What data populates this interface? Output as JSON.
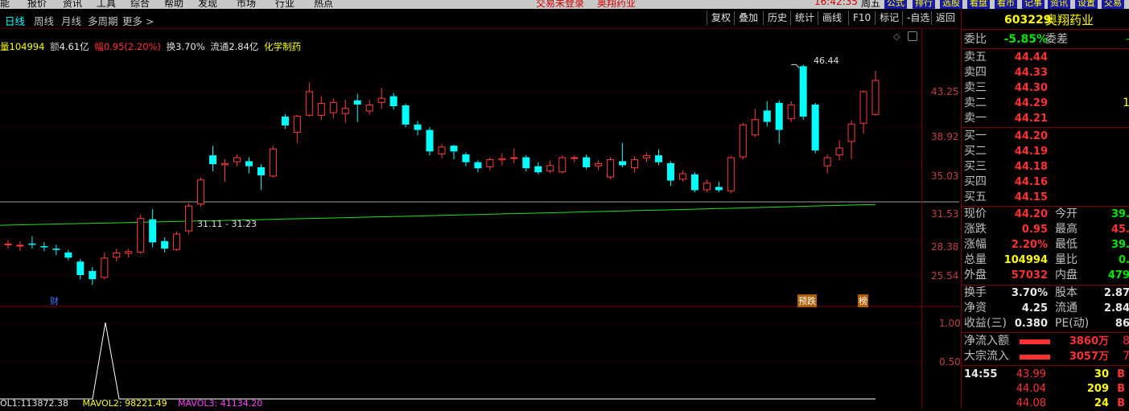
{
  "menubar": {
    "items": [
      "能",
      "报价",
      "资讯",
      "工具",
      "综合",
      "帮助",
      "发现",
      "市场",
      "行业",
      "热点"
    ],
    "status_left": "交易未登录",
    "stock_name": "奥翔药业",
    "time": "16:42:35",
    "weekday": "周五",
    "buttons": [
      "公式",
      "排行",
      "选股",
      "看盘",
      "看市",
      "记事",
      "资讯",
      "设置",
      "交易"
    ]
  },
  "toolbar": {
    "periods": [
      "日线",
      "周线",
      "月线",
      "多周期",
      "更多 >"
    ],
    "active_period": "日线",
    "buttons": [
      "复权",
      "叠加",
      "历史",
      "统计",
      "画线",
      "F10",
      "标记",
      "-自选",
      "返回"
    ]
  },
  "info": {
    "volume_label": "量",
    "volume": "104994",
    "amount_label": "额",
    "amount": "4.61亿",
    "amp_label": "幅",
    "amp": "0.95(2.20%)",
    "turnover_label": "换",
    "turnover": "3.70%",
    "float_label": "流通",
    "float": "2.84亿",
    "sector": "化学制药"
  },
  "chart_data": {
    "type": "candlestick",
    "y_ticks": [
      "43.25",
      "38.92",
      "35.03",
      "31.53",
      "28.38",
      "25.54"
    ],
    "y_tick_values": [
      43.25,
      38.92,
      35.03,
      31.53,
      28.38,
      25.54
    ],
    "lower_ticks": [
      "1.00",
      "0.50"
    ],
    "lower_tick_values": [
      1.0,
      0.5
    ],
    "annotations": {
      "high_label": "46.44",
      "range_label": "31.11 - 31.23",
      "markers": [
        "财",
        "预跌",
        "榜"
      ]
    },
    "ylim": [
      23.4,
      48.0
    ],
    "candles": [
      {
        "o": 27.9,
        "c": 28.0,
        "h": 28.3,
        "l": 27.6
      },
      {
        "o": 27.8,
        "c": 27.9,
        "h": 28.2,
        "l": 27.4
      },
      {
        "o": 28.0,
        "c": 27.9,
        "h": 28.6,
        "l": 27.6
      },
      {
        "o": 27.8,
        "c": 27.7,
        "h": 28.1,
        "l": 27.4
      },
      {
        "o": 27.6,
        "c": 27.5,
        "h": 27.9,
        "l": 27.1
      },
      {
        "o": 27.3,
        "c": 26.9,
        "h": 27.5,
        "l": 26.7
      },
      {
        "o": 26.6,
        "c": 25.6,
        "h": 26.8,
        "l": 25.3
      },
      {
        "o": 25.9,
        "c": 25.3,
        "h": 26.2,
        "l": 24.9
      },
      {
        "o": 25.4,
        "c": 26.9,
        "h": 27.3,
        "l": 25.3
      },
      {
        "o": 26.9,
        "c": 27.3,
        "h": 27.6,
        "l": 26.6
      },
      {
        "o": 27.2,
        "c": 27.4,
        "h": 27.6,
        "l": 26.9
      },
      {
        "o": 27.3,
        "c": 30.1,
        "h": 30.4,
        "l": 27.2
      },
      {
        "o": 30.0,
        "c": 28.1,
        "h": 30.9,
        "l": 27.7
      },
      {
        "o": 28.2,
        "c": 27.6,
        "h": 28.5,
        "l": 27.3
      },
      {
        "o": 27.5,
        "c": 28.8,
        "h": 29.0,
        "l": 27.4
      },
      {
        "o": 29.0,
        "c": 31.2,
        "h": 31.4,
        "l": 28.8
      },
      {
        "o": 31.3,
        "c": 33.6,
        "h": 33.8,
        "l": 31.1
      },
      {
        "o": 36.0,
        "c": 35.1,
        "h": 37.0,
        "l": 34.4
      },
      {
        "o": 35.0,
        "c": 35.2,
        "h": 35.6,
        "l": 33.4
      },
      {
        "o": 35.3,
        "c": 35.8,
        "h": 36.1,
        "l": 34.9
      },
      {
        "o": 35.4,
        "c": 34.9,
        "h": 35.8,
        "l": 34.2
      },
      {
        "o": 34.8,
        "c": 34.0,
        "h": 35.1,
        "l": 32.6
      },
      {
        "o": 33.9,
        "c": 36.7,
        "h": 37.0,
        "l": 33.8
      },
      {
        "o": 40.2,
        "c": 39.2,
        "h": 40.5,
        "l": 38.8
      },
      {
        "o": 38.4,
        "c": 40.3,
        "h": 40.4,
        "l": 37.3
      },
      {
        "o": 40.3,
        "c": 43.2,
        "h": 44.3,
        "l": 40.2
      },
      {
        "o": 40.3,
        "c": 41.8,
        "h": 42.6,
        "l": 39.8
      },
      {
        "o": 40.6,
        "c": 41.9,
        "h": 42.3,
        "l": 40.0
      },
      {
        "o": 40.5,
        "c": 41.2,
        "h": 42.2,
        "l": 39.5
      },
      {
        "o": 42.1,
        "c": 41.6,
        "h": 42.9,
        "l": 39.6
      },
      {
        "o": 40.8,
        "c": 41.6,
        "h": 42.2,
        "l": 40.4
      },
      {
        "o": 41.8,
        "c": 42.4,
        "h": 43.6,
        "l": 41.1
      },
      {
        "o": 42.6,
        "c": 41.4,
        "h": 43.0,
        "l": 41.0
      },
      {
        "o": 41.5,
        "c": 39.3,
        "h": 41.7,
        "l": 39.0
      },
      {
        "o": 39.3,
        "c": 38.7,
        "h": 39.7,
        "l": 38.1
      },
      {
        "o": 38.7,
        "c": 36.4,
        "h": 39.0,
        "l": 36.0
      },
      {
        "o": 36.1,
        "c": 36.9,
        "h": 37.2,
        "l": 35.7
      },
      {
        "o": 37.0,
        "c": 36.4,
        "h": 37.1,
        "l": 35.6
      },
      {
        "o": 36.1,
        "c": 35.3,
        "h": 36.3,
        "l": 34.9
      },
      {
        "o": 35.3,
        "c": 34.7,
        "h": 35.5,
        "l": 34.3
      },
      {
        "o": 34.8,
        "c": 35.6,
        "h": 35.8,
        "l": 34.5
      },
      {
        "o": 35.5,
        "c": 35.7,
        "h": 36.2,
        "l": 35.0
      },
      {
        "o": 35.8,
        "c": 35.8,
        "h": 36.7,
        "l": 35.2
      },
      {
        "o": 35.8,
        "c": 34.7,
        "h": 36.0,
        "l": 34.4
      },
      {
        "o": 34.9,
        "c": 34.3,
        "h": 35.3,
        "l": 34.1
      },
      {
        "o": 34.4,
        "c": 35.0,
        "h": 35.5,
        "l": 34.2
      },
      {
        "o": 34.3,
        "c": 35.8,
        "h": 36.0,
        "l": 34.2
      },
      {
        "o": 35.7,
        "c": 35.8,
        "h": 36.0,
        "l": 35.3
      },
      {
        "o": 35.8,
        "c": 34.8,
        "h": 36.1,
        "l": 34.6
      },
      {
        "o": 34.9,
        "c": 35.2,
        "h": 35.5,
        "l": 34.5
      },
      {
        "o": 33.8,
        "c": 35.6,
        "h": 35.8,
        "l": 33.6
      },
      {
        "o": 35.4,
        "c": 35.0,
        "h": 37.3,
        "l": 34.8
      },
      {
        "o": 34.7,
        "c": 35.6,
        "h": 35.9,
        "l": 34.3
      },
      {
        "o": 35.7,
        "c": 36.0,
        "h": 36.3,
        "l": 35.3
      },
      {
        "o": 36.0,
        "c": 35.3,
        "h": 36.6,
        "l": 35.0
      },
      {
        "o": 35.2,
        "c": 33.5,
        "h": 35.4,
        "l": 33.0
      },
      {
        "o": 33.6,
        "c": 34.2,
        "h": 34.5,
        "l": 33.4
      },
      {
        "o": 34.1,
        "c": 32.6,
        "h": 34.3,
        "l": 32.4
      },
      {
        "o": 32.6,
        "c": 33.3,
        "h": 33.6,
        "l": 32.4
      },
      {
        "o": 32.9,
        "c": 32.6,
        "h": 33.4,
        "l": 32.4
      },
      {
        "o": 32.5,
        "c": 35.8,
        "h": 35.9,
        "l": 32.3
      },
      {
        "o": 35.8,
        "c": 39.3,
        "h": 39.5,
        "l": 35.6
      },
      {
        "o": 38.1,
        "c": 39.9,
        "h": 41.1,
        "l": 37.9
      },
      {
        "o": 40.9,
        "c": 39.6,
        "h": 42.0,
        "l": 39.1
      },
      {
        "o": 41.8,
        "c": 38.7,
        "h": 42.1,
        "l": 37.2
      },
      {
        "o": 39.9,
        "c": 41.6,
        "h": 42.0,
        "l": 39.6
      },
      {
        "o": 46.4,
        "c": 40.2,
        "h": 46.6,
        "l": 39.8
      },
      {
        "o": 41.6,
        "c": 36.5,
        "h": 41.8,
        "l": 36.2
      },
      {
        "o": 34.9,
        "c": 35.8,
        "h": 36.1,
        "l": 34.2
      },
      {
        "o": 36.0,
        "c": 36.8,
        "h": 37.6,
        "l": 35.5
      },
      {
        "o": 37.4,
        "c": 39.4,
        "h": 39.8,
        "l": 35.6
      },
      {
        "o": 39.4,
        "c": 43.2,
        "h": 43.3,
        "l": 38.3
      },
      {
        "o": 40.4,
        "c": 44.6,
        "h": 45.8,
        "l": 40.3
      }
    ],
    "ma_line": {
      "start": 29.5,
      "end": 31.3
    },
    "lower_line_peak": 1.0
  },
  "lower_legend": {
    "vol": "OL1:113872.38",
    "mavol2": "MAVOL2: 98221.49",
    "mavol3": "MAVOL3: 41134.20"
  },
  "quote": {
    "code": "603229",
    "name": "奥翔药业",
    "webi_label": "委比",
    "webi": "-5.85%",
    "weicha_label": "委差",
    "weicha": "-",
    "asks": [
      {
        "label": "卖五",
        "price": "44.44",
        "vol": ""
      },
      {
        "label": "卖四",
        "price": "44.33",
        "vol": ""
      },
      {
        "label": "卖三",
        "price": "44.30",
        "vol": ""
      },
      {
        "label": "卖二",
        "price": "44.29",
        "vol": "1"
      },
      {
        "label": "卖一",
        "price": "44.21",
        "vol": ""
      }
    ],
    "bids": [
      {
        "label": "买一",
        "price": "44.20",
        "vol": ""
      },
      {
        "label": "买二",
        "price": "44.19",
        "vol": ""
      },
      {
        "label": "买三",
        "price": "44.18",
        "vol": ""
      },
      {
        "label": "买四",
        "price": "44.16",
        "vol": ""
      },
      {
        "label": "买五",
        "price": "44.15",
        "vol": ""
      }
    ],
    "stats": [
      {
        "l1": "现价",
        "v1": "44.20",
        "c1": "red",
        "l2": "今开",
        "v2": "39.",
        "c2": "green"
      },
      {
        "l1": "涨跌",
        "v1": "0.95",
        "c1": "red",
        "l2": "最高",
        "v2": "45.",
        "c2": "red"
      },
      {
        "l1": "涨幅",
        "v1": "2.20%",
        "c1": "red",
        "l2": "最低",
        "v2": "39.",
        "c2": "green"
      },
      {
        "l1": "总量",
        "v1": "104994",
        "c1": "yellow",
        "l2": "量比",
        "v2": "0.",
        "c2": "green"
      },
      {
        "l1": "外盘",
        "v1": "57032",
        "c1": "red",
        "l2": "内盘",
        "v2": "479",
        "c2": "green"
      }
    ],
    "stats2": [
      {
        "l1": "换手",
        "v1": "3.70%",
        "l2": "股本",
        "v2": "2.87"
      },
      {
        "l1": "净资",
        "v1": "4.25",
        "l2": "流通",
        "v2": "2.84"
      },
      {
        "l1": "收益(三)",
        "v1": "0.380",
        "l2": "PE(动)",
        "v2": "86"
      }
    ],
    "flows": [
      {
        "label": "净流入额",
        "value": "3860万",
        "extra": "8"
      },
      {
        "label": "大宗流入",
        "value": "3057万",
        "extra": "7"
      }
    ],
    "ticks_time": "14:55",
    "ticks": [
      {
        "price": "43.99",
        "vol": "30",
        "side": "B"
      },
      {
        "price": "44.04",
        "vol": "209",
        "side": "B"
      },
      {
        "price": "44.08",
        "vol": "24",
        "side": "B"
      }
    ]
  }
}
